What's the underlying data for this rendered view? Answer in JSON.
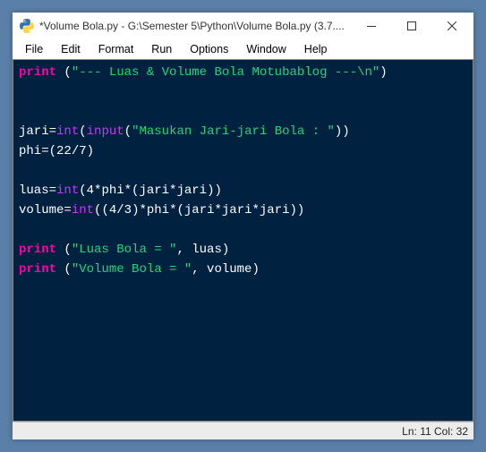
{
  "titlebar": {
    "title": "*Volume Bola.py - G:\\Semester 5\\Python\\Volume Bola.py (3.7...."
  },
  "menu": {
    "items": [
      "File",
      "Edit",
      "Format",
      "Run",
      "Options",
      "Window",
      "Help"
    ]
  },
  "code": {
    "lines": [
      [
        {
          "cls": "tok-kw",
          "t": "print"
        },
        {
          "cls": "tok-punc",
          "t": " ("
        },
        {
          "cls": "tok-str",
          "t": "\"--- Luas & Volume Bola Motubablog ---\\n\""
        },
        {
          "cls": "tok-punc",
          "t": ")"
        }
      ],
      [],
      [],
      [
        {
          "cls": "tok-var",
          "t": "jari"
        },
        {
          "cls": "tok-punc",
          "t": "="
        },
        {
          "cls": "tok-func",
          "t": "int"
        },
        {
          "cls": "tok-punc",
          "t": "("
        },
        {
          "cls": "tok-func",
          "t": "input"
        },
        {
          "cls": "tok-punc",
          "t": "("
        },
        {
          "cls": "tok-str",
          "t": "\"Masukan Jari-jari Bola : \""
        },
        {
          "cls": "tok-punc",
          "t": "))"
        }
      ],
      [
        {
          "cls": "tok-var",
          "t": "phi"
        },
        {
          "cls": "tok-punc",
          "t": "=("
        },
        {
          "cls": "tok-num",
          "t": "22"
        },
        {
          "cls": "tok-punc",
          "t": "/"
        },
        {
          "cls": "tok-num",
          "t": "7"
        },
        {
          "cls": "tok-punc",
          "t": ")"
        }
      ],
      [],
      [
        {
          "cls": "tok-var",
          "t": "luas"
        },
        {
          "cls": "tok-punc",
          "t": "="
        },
        {
          "cls": "tok-func",
          "t": "int"
        },
        {
          "cls": "tok-punc",
          "t": "("
        },
        {
          "cls": "tok-num",
          "t": "4"
        },
        {
          "cls": "tok-punc",
          "t": "*phi*(jari*jari))"
        }
      ],
      [
        {
          "cls": "tok-var",
          "t": "volume"
        },
        {
          "cls": "tok-punc",
          "t": "="
        },
        {
          "cls": "tok-func",
          "t": "int"
        },
        {
          "cls": "tok-punc",
          "t": "(("
        },
        {
          "cls": "tok-num",
          "t": "4"
        },
        {
          "cls": "tok-punc",
          "t": "/"
        },
        {
          "cls": "tok-num",
          "t": "3"
        },
        {
          "cls": "tok-punc",
          "t": ")*phi*(jari*jari*jari))"
        }
      ],
      [],
      [
        {
          "cls": "tok-kw",
          "t": "print"
        },
        {
          "cls": "tok-punc",
          "t": " ("
        },
        {
          "cls": "tok-str",
          "t": "\"Luas Bola = \""
        },
        {
          "cls": "tok-punc",
          "t": ", luas)"
        }
      ],
      [
        {
          "cls": "tok-kw",
          "t": "print"
        },
        {
          "cls": "tok-punc",
          "t": " ("
        },
        {
          "cls": "tok-str",
          "t": "\"Volume Bola = \""
        },
        {
          "cls": "tok-punc",
          "t": ", volume)"
        }
      ]
    ]
  },
  "statusbar": {
    "position": "Ln: 11  Col: 32"
  }
}
